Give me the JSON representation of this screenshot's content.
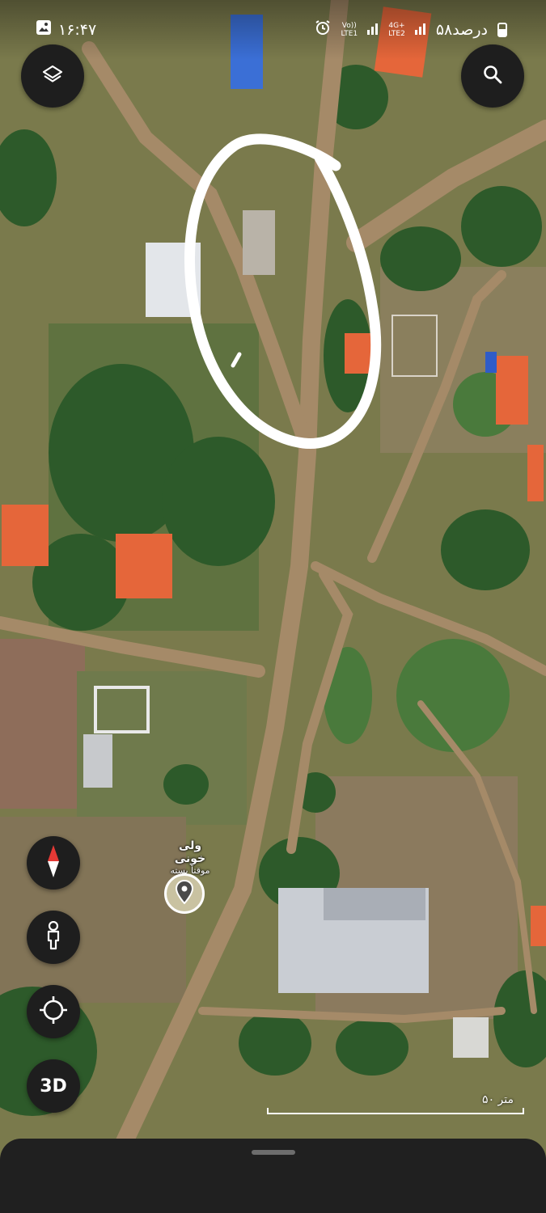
{
  "status_bar": {
    "time": "۱۶:۴۷",
    "battery": "۵۸درصد",
    "network_1": {
      "top": "4G+",
      "bottom": "LTE2"
    },
    "network_2": {
      "top": "Vo))",
      "bottom": "LTE1"
    },
    "network_3": {
      "top": "Vo))",
      "bottom": "LTE2"
    },
    "icons": [
      "gallery-icon",
      "alarm-icon",
      "signal-icon",
      "battery-icon"
    ]
  },
  "map": {
    "type": "satellite",
    "annotation": "hand-drawn white loop around road section",
    "place": {
      "name": "ولی خونی",
      "status": "موقتاً بسته"
    },
    "scale": {
      "label": "۵۰ متر"
    }
  },
  "controls": {
    "layers": "layers-icon",
    "search": "search-icon",
    "compass": "compass-icon",
    "street_view": "pegman-icon",
    "my_location": "my-location-icon",
    "three_d_label": "3D"
  },
  "colors": {
    "button_bg": "#1e1e1e",
    "sheet_bg": "#202020",
    "roof_orange": "#e5663a",
    "compass_red": "#e53935",
    "annotation": "#ffffff"
  }
}
